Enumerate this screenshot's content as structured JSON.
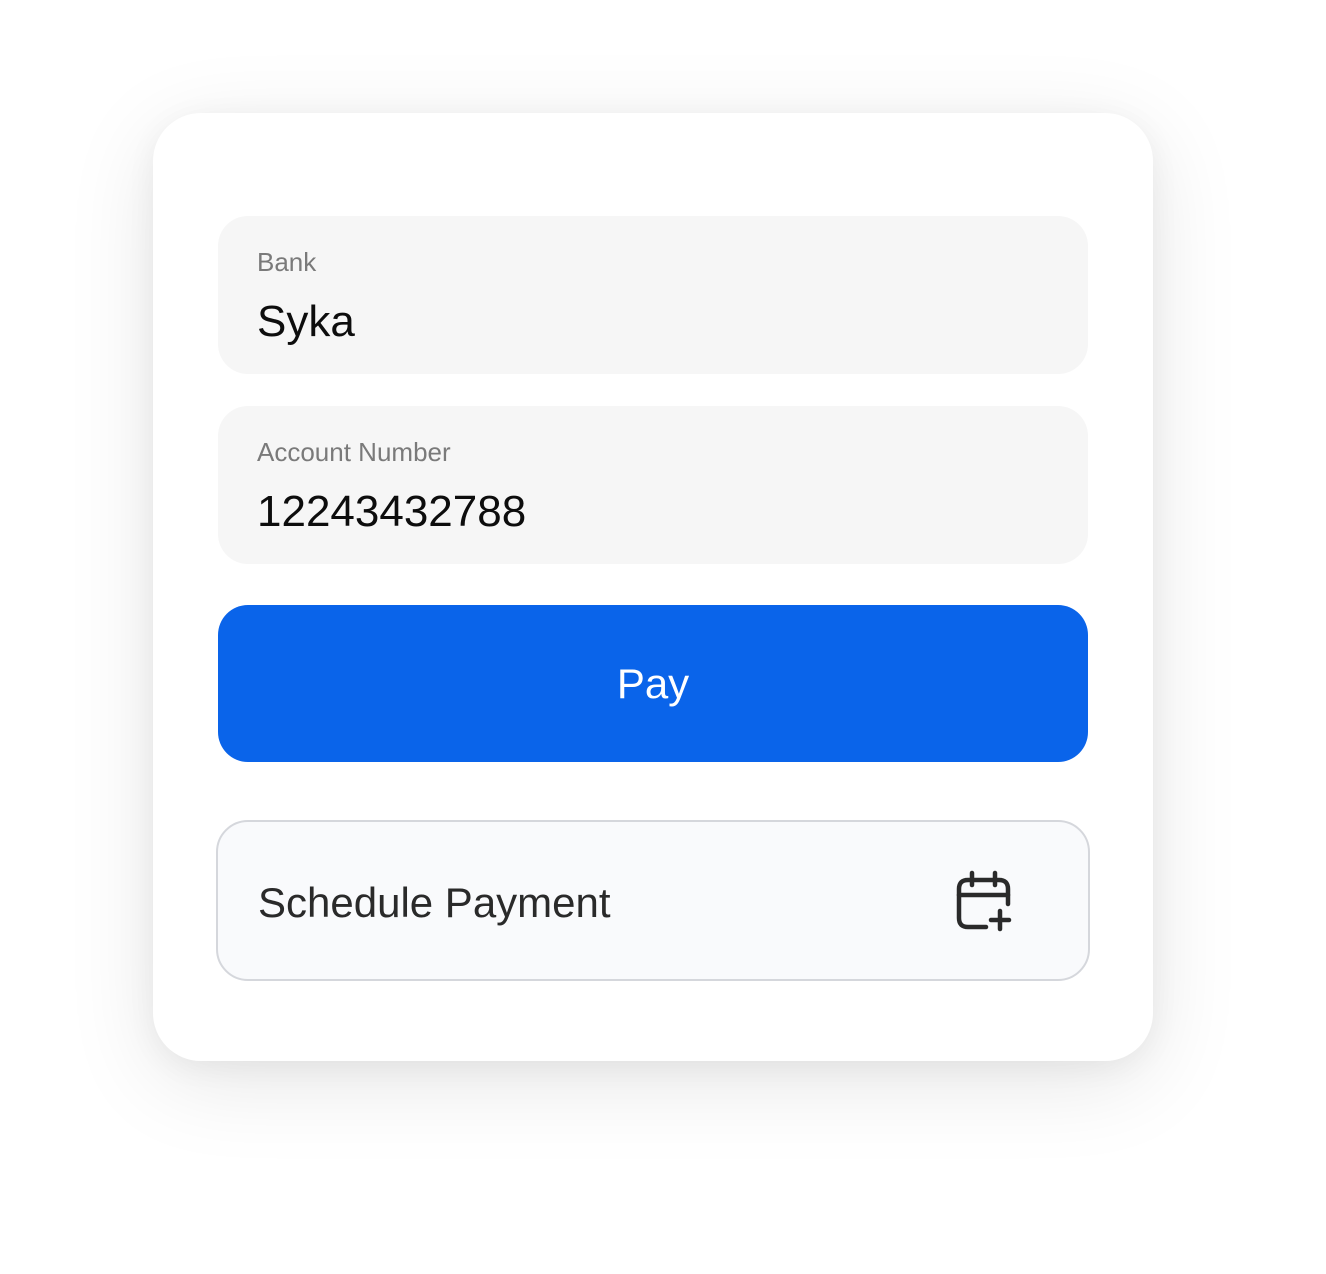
{
  "form": {
    "bank": {
      "label": "Bank",
      "value": "Syka"
    },
    "account_number": {
      "label": "Account Number",
      "value": "12243432788"
    },
    "pay_button_label": "Pay",
    "schedule_button": {
      "label": "Schedule Payment",
      "icon": "calendar-plus-icon"
    }
  },
  "colors": {
    "primary": "#0a64ea",
    "field_background": "#f6f6f6",
    "label_text": "#7a7a7a"
  }
}
